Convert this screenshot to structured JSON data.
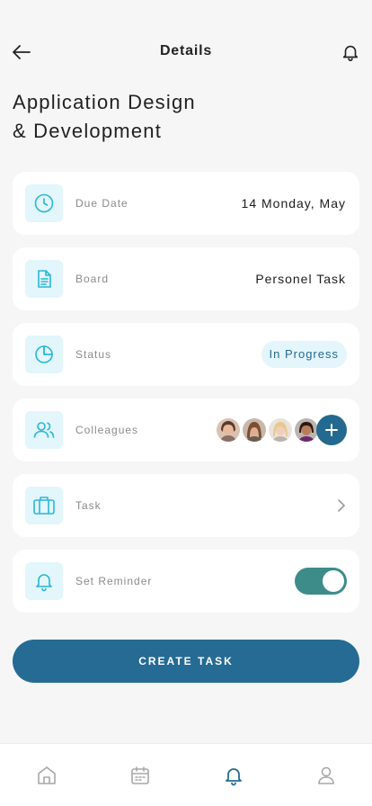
{
  "header": {
    "title": "Details"
  },
  "task": {
    "title_line1": "Application Design",
    "title_line2": "& Development"
  },
  "rows": {
    "due_date": {
      "label": "Due Date",
      "value": "14 Monday, May"
    },
    "board": {
      "label": "Board",
      "value": "Personel Task"
    },
    "status": {
      "label": "Status",
      "value": "In Progress"
    },
    "colleagues": {
      "label": "Colleagues"
    },
    "task": {
      "label": "Task"
    },
    "reminder": {
      "label": "Set Reminder",
      "enabled": true
    }
  },
  "actions": {
    "create_label": "CREATE TASK"
  },
  "nav": {
    "items": [
      "home-icon",
      "calendar-icon",
      "bell-icon",
      "user-icon"
    ],
    "active": "bell-icon"
  },
  "colors": {
    "accent": "#256b93",
    "icon_tint": "#29b6d6",
    "icon_bg": "#e2f6fb",
    "toggle_on": "#3d8c8a"
  }
}
